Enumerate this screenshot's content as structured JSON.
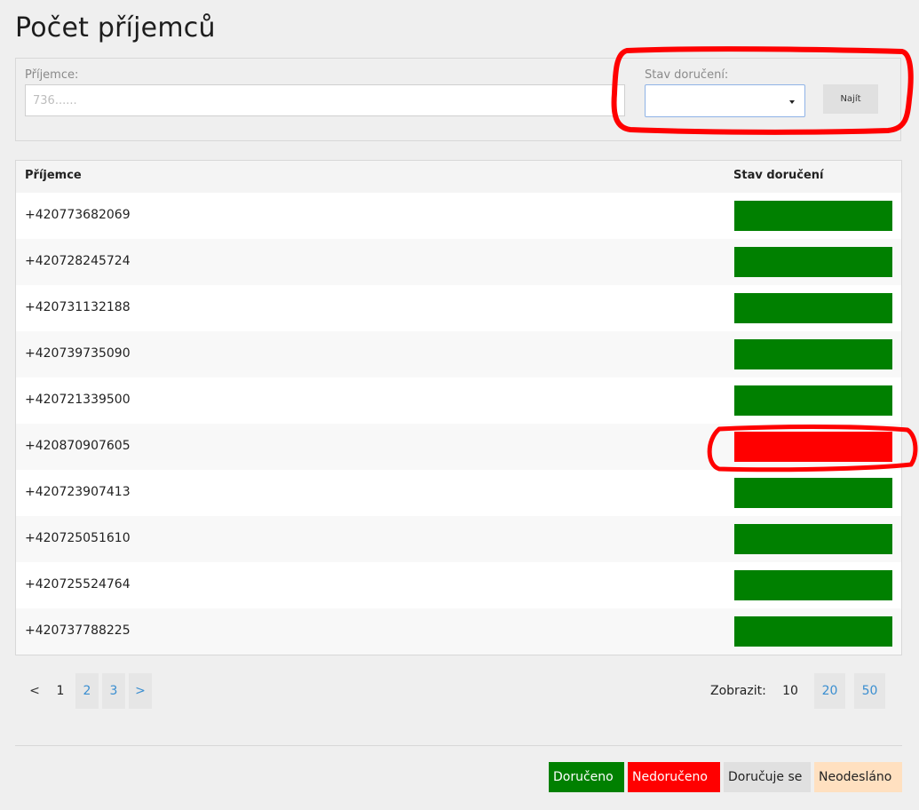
{
  "page": {
    "title": "Počet příjemců"
  },
  "filter": {
    "recipient_label": "Příjemce:",
    "recipient_placeholder": "736......",
    "recipient_value": "",
    "state_label": "Stav doručení:",
    "state_value": "",
    "find_button": "Najít"
  },
  "table": {
    "headers": {
      "recipient": "Příjemce",
      "state": "Stav doručení"
    },
    "rows": [
      {
        "recipient": "+420773682069",
        "state": "delivered"
      },
      {
        "recipient": "+420728245724",
        "state": "delivered"
      },
      {
        "recipient": "+420731132188",
        "state": "delivered"
      },
      {
        "recipient": "+420739735090",
        "state": "delivered"
      },
      {
        "recipient": "+420721339500",
        "state": "delivered"
      },
      {
        "recipient": "+420870907605",
        "state": "undelivered"
      },
      {
        "recipient": "+420723907413",
        "state": "delivered"
      },
      {
        "recipient": "+420725051610",
        "state": "delivered"
      },
      {
        "recipient": "+420725524764",
        "state": "delivered"
      },
      {
        "recipient": "+420737788225",
        "state": "delivered"
      }
    ]
  },
  "pagination": {
    "prev": "<",
    "pages": [
      "1",
      "2",
      "3"
    ],
    "next": ">",
    "current": "1"
  },
  "per_page": {
    "label": "Zobrazit:",
    "options": [
      "10",
      "20",
      "50"
    ],
    "selected": "10"
  },
  "legend": {
    "delivered": "Doručeno",
    "undelivered": "Nedoručeno",
    "delivering": "Doručuje se",
    "not_sent": "Neodesláno"
  },
  "colors": {
    "delivered": "#008000",
    "undelivered": "#ff0000",
    "delivering": "#e0e0e0",
    "not_sent": "#ffe0c0",
    "link": "#3a8ed0",
    "annotation": "#ff0000"
  }
}
